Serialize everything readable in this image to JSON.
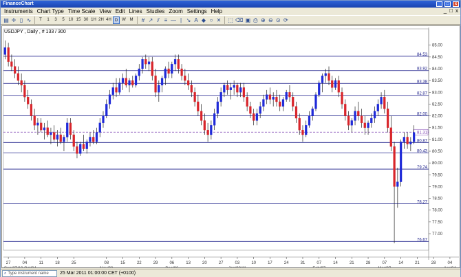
{
  "window": {
    "title": "FinanceChart",
    "controls": [
      "_",
      "□",
      "x"
    ]
  },
  "menu": {
    "items": [
      "Instruments",
      "Chart Type",
      "Time Scale",
      "View",
      "Edit",
      "Lines",
      "Studies",
      "Zoom",
      "Settings",
      "Help"
    ],
    "mdi": [
      "_",
      "□",
      "x"
    ]
  },
  "toolbar": {
    "timeframes": [
      "T",
      "1",
      "3",
      "5",
      "10",
      "15",
      "30",
      "1H",
      "2H",
      "4H",
      "D",
      "W",
      "M"
    ],
    "selected": "D"
  },
  "chart_info": "USDJPY , Daily , # 133 / 300",
  "status": {
    "search_placeholder": "Type instrument name",
    "datetime": "25 Mar 2011 01:00:00 CET (+0100)"
  },
  "colors": {
    "up": "#1f2ad8",
    "down": "#d8252b",
    "level": "#1c1f8a",
    "current": "#7a3fb0"
  },
  "chart_data": {
    "type": "candlestick",
    "title": "",
    "instrument": "USDJPY",
    "timeframe": "Daily",
    "ylim": [
      76.3,
      85.4
    ],
    "y_ticks": [
      "85.00",
      "84.50",
      "84.00",
      "83.50",
      "83.00",
      "82.50",
      "82.00",
      "81.50",
      "81.00",
      "80.50",
      "80.00",
      "79.50",
      "79.00",
      "78.50",
      "78.00",
      "77.50",
      "77.00"
    ],
    "levels": [
      {
        "label": "84.53",
        "value": 84.53
      },
      {
        "label": "83.92",
        "value": 83.92
      },
      {
        "label": "83.38",
        "value": 83.38
      },
      {
        "label": "82.87",
        "value": 82.87
      },
      {
        "label": "82.00",
        "value": 82.0
      },
      {
        "label": "80.87",
        "value": 80.87
      },
      {
        "label": "80.43",
        "value": 80.43
      },
      {
        "label": "79.74",
        "value": 79.74
      },
      {
        "label": "78.27",
        "value": 78.27
      },
      {
        "label": "76.67",
        "value": 76.67
      }
    ],
    "current_price": {
      "label": "81.31",
      "value": 81.31
    },
    "x_labels": [
      {
        "i": 1,
        "label": "27"
      },
      {
        "i": 6,
        "label": "04"
      },
      {
        "i": 11,
        "label": "11"
      },
      {
        "i": 16,
        "label": "18"
      },
      {
        "i": 21,
        "label": "25"
      },
      {
        "i": 31,
        "label": "08"
      },
      {
        "i": 36,
        "label": "15"
      },
      {
        "i": 41,
        "label": "22"
      },
      {
        "i": 46,
        "label": "29"
      },
      {
        "i": 51,
        "label": "06"
      },
      {
        "i": 56,
        "label": "13"
      },
      {
        "i": 61,
        "label": "20"
      },
      {
        "i": 66,
        "label": "27"
      },
      {
        "i": 71,
        "label": "03"
      },
      {
        "i": 76,
        "label": "10"
      },
      {
        "i": 81,
        "label": "17"
      },
      {
        "i": 86,
        "label": "24"
      },
      {
        "i": 91,
        "label": "31"
      },
      {
        "i": 96,
        "label": "07"
      },
      {
        "i": 101,
        "label": "14"
      },
      {
        "i": 106,
        "label": "21"
      },
      {
        "i": 111,
        "label": "28"
      },
      {
        "i": 116,
        "label": "07"
      },
      {
        "i": 121,
        "label": "14"
      },
      {
        "i": 126,
        "label": "21"
      },
      {
        "i": 131,
        "label": "28"
      },
      {
        "i": 136,
        "label": "04"
      }
    ],
    "period_labels": [
      {
        "i": 0,
        "label": "Sep/27/10 Oct/04"
      },
      {
        "i": 31,
        "label": "Nov/08"
      },
      {
        "i": 51,
        "label": "Dec/06"
      },
      {
        "i": 71,
        "label": "Jan/03/11"
      },
      {
        "i": 96,
        "label": "Feb/07"
      },
      {
        "i": 116,
        "label": "Mar/07"
      },
      {
        "i": 136,
        "label": "Apr/04"
      }
    ],
    "candles": [
      [
        84.6,
        85.2,
        84.4,
        84.9
      ],
      [
        84.9,
        85.1,
        84.1,
        84.3
      ],
      [
        84.3,
        84.6,
        83.9,
        84.1
      ],
      [
        84.1,
        84.4,
        83.6,
        83.8
      ],
      [
        83.8,
        84.1,
        83.3,
        83.5
      ],
      [
        83.5,
        83.8,
        83.0,
        83.3
      ],
      [
        83.3,
        83.5,
        82.6,
        82.8
      ],
      [
        82.8,
        83.1,
        82.3,
        82.5
      ],
      [
        82.5,
        82.7,
        81.8,
        82.0
      ],
      [
        82.0,
        82.3,
        81.4,
        81.6
      ],
      [
        81.6,
        81.9,
        81.2,
        81.7
      ],
      [
        81.7,
        81.9,
        81.3,
        81.4
      ],
      [
        81.4,
        81.7,
        81.0,
        81.5
      ],
      [
        81.5,
        81.8,
        81.1,
        81.2
      ],
      [
        81.2,
        81.5,
        80.8,
        81.3
      ],
      [
        81.3,
        81.6,
        80.9,
        81.0
      ],
      [
        81.0,
        81.4,
        80.7,
        81.2
      ],
      [
        81.2,
        81.5,
        80.8,
        80.9
      ],
      [
        80.9,
        81.2,
        80.5,
        81.1
      ],
      [
        81.1,
        81.9,
        80.9,
        81.7
      ],
      [
        81.7,
        81.9,
        81.0,
        81.2
      ],
      [
        81.2,
        81.4,
        80.5,
        80.7
      ],
      [
        80.7,
        80.9,
        80.2,
        80.4
      ],
      [
        80.4,
        80.9,
        80.3,
        80.8
      ],
      [
        80.8,
        81.2,
        80.5,
        80.6
      ],
      [
        80.6,
        81.0,
        80.4,
        80.9
      ],
      [
        80.9,
        81.3,
        80.7,
        81.1
      ],
      [
        81.1,
        81.4,
        80.8,
        80.9
      ],
      [
        80.9,
        81.5,
        80.8,
        81.3
      ],
      [
        81.3,
        81.9,
        81.1,
        81.7
      ],
      [
        81.7,
        82.2,
        81.5,
        82.0
      ],
      [
        82.0,
        82.7,
        81.9,
        82.5
      ],
      [
        82.5,
        83.1,
        82.3,
        82.9
      ],
      [
        82.9,
        83.4,
        82.7,
        83.2
      ],
      [
        83.2,
        83.6,
        82.8,
        83.0
      ],
      [
        83.0,
        83.6,
        82.9,
        83.4
      ],
      [
        83.4,
        83.8,
        83.1,
        83.6
      ],
      [
        83.6,
        84.0,
        83.2,
        83.3
      ],
      [
        83.3,
        83.6,
        83.0,
        83.5
      ],
      [
        83.5,
        83.7,
        83.2,
        83.3
      ],
      [
        83.3,
        83.8,
        83.2,
        83.7
      ],
      [
        83.7,
        84.2,
        83.5,
        84.0
      ],
      [
        84.0,
        84.5,
        83.8,
        84.4
      ],
      [
        84.4,
        84.6,
        84.0,
        84.2
      ],
      [
        84.2,
        84.5,
        83.9,
        84.3
      ],
      [
        84.3,
        84.5,
        83.5,
        83.7
      ],
      [
        83.7,
        84.0,
        82.8,
        83.0
      ],
      [
        83.0,
        83.5,
        82.6,
        83.3
      ],
      [
        83.3,
        83.7,
        83.0,
        83.6
      ],
      [
        83.6,
        84.1,
        83.3,
        84.0
      ],
      [
        84.0,
        84.3,
        83.6,
        83.8
      ],
      [
        83.8,
        84.3,
        83.6,
        84.2
      ],
      [
        84.2,
        84.6,
        83.9,
        84.4
      ],
      [
        84.4,
        84.6,
        83.8,
        84.0
      ],
      [
        84.0,
        84.2,
        83.5,
        83.7
      ],
      [
        83.7,
        84.0,
        83.3,
        83.5
      ],
      [
        83.5,
        83.8,
        83.1,
        83.3
      ],
      [
        83.3,
        83.5,
        82.8,
        83.0
      ],
      [
        83.0,
        83.2,
        82.4,
        82.6
      ],
      [
        82.6,
        82.9,
        82.0,
        82.2
      ],
      [
        82.2,
        82.5,
        81.6,
        81.8
      ],
      [
        81.8,
        82.1,
        81.2,
        81.4
      ],
      [
        81.4,
        81.7,
        80.9,
        81.2
      ],
      [
        81.2,
        81.8,
        81.0,
        81.6
      ],
      [
        81.6,
        82.3,
        81.4,
        82.1
      ],
      [
        82.1,
        82.8,
        81.9,
        82.6
      ],
      [
        82.6,
        83.2,
        82.4,
        83.0
      ],
      [
        83.0,
        83.4,
        82.8,
        83.3
      ],
      [
        83.3,
        83.5,
        82.9,
        83.1
      ],
      [
        83.1,
        83.4,
        82.7,
        83.2
      ],
      [
        83.2,
        83.5,
        82.9,
        83.3
      ],
      [
        83.3,
        83.4,
        82.8,
        83.0
      ],
      [
        83.0,
        83.4,
        82.8,
        83.2
      ],
      [
        83.2,
        83.4,
        82.6,
        82.8
      ],
      [
        82.8,
        83.0,
        82.2,
        82.4
      ],
      [
        82.4,
        82.6,
        81.9,
        82.1
      ],
      [
        82.1,
        82.3,
        81.6,
        81.8
      ],
      [
        81.8,
        82.3,
        81.6,
        82.1
      ],
      [
        82.1,
        82.6,
        81.9,
        82.4
      ],
      [
        82.4,
        82.9,
        82.2,
        82.7
      ],
      [
        82.7,
        83.1,
        82.5,
        82.9
      ],
      [
        82.9,
        83.2,
        82.5,
        82.7
      ],
      [
        82.7,
        83.0,
        82.4,
        82.8
      ],
      [
        82.8,
        83.1,
        82.4,
        82.6
      ],
      [
        82.6,
        82.9,
        82.2,
        82.4
      ],
      [
        82.4,
        82.8,
        82.2,
        82.7
      ],
      [
        82.7,
        83.1,
        82.6,
        83.0
      ],
      [
        83.0,
        83.3,
        82.6,
        82.8
      ],
      [
        82.8,
        83.0,
        82.2,
        82.4
      ],
      [
        82.4,
        82.6,
        81.7,
        81.9
      ],
      [
        81.9,
        82.1,
        81.2,
        81.4
      ],
      [
        81.4,
        81.6,
        80.9,
        81.2
      ],
      [
        81.2,
        81.8,
        81.1,
        81.6
      ],
      [
        81.6,
        82.2,
        81.5,
        82.0
      ],
      [
        82.0,
        82.4,
        81.8,
        82.3
      ],
      [
        82.3,
        83.0,
        82.2,
        82.9
      ],
      [
        82.9,
        83.5,
        82.8,
        83.4
      ],
      [
        83.4,
        83.8,
        83.0,
        83.7
      ],
      [
        83.7,
        84.0,
        83.4,
        83.8
      ],
      [
        83.8,
        84.1,
        83.3,
        83.5
      ],
      [
        83.5,
        83.7,
        83.0,
        83.2
      ],
      [
        83.2,
        83.6,
        83.1,
        83.5
      ],
      [
        83.5,
        83.7,
        82.8,
        83.0
      ],
      [
        83.0,
        83.2,
        82.3,
        82.5
      ],
      [
        82.5,
        82.7,
        81.8,
        82.0
      ],
      [
        82.0,
        82.2,
        81.4,
        81.6
      ],
      [
        81.6,
        81.9,
        81.3,
        81.8
      ],
      [
        81.8,
        82.4,
        81.6,
        82.2
      ],
      [
        82.2,
        82.6,
        81.8,
        82.0
      ],
      [
        82.0,
        82.3,
        81.5,
        81.7
      ],
      [
        81.7,
        82.0,
        81.2,
        81.5
      ],
      [
        81.5,
        81.8,
        81.2,
        81.7
      ],
      [
        81.7,
        82.1,
        81.5,
        81.9
      ],
      [
        81.9,
        82.4,
        81.7,
        82.2
      ],
      [
        82.2,
        82.7,
        82.0,
        82.5
      ],
      [
        82.5,
        83.0,
        82.3,
        82.8
      ],
      [
        82.8,
        83.1,
        82.1,
        82.3
      ],
      [
        82.3,
        82.6,
        81.3,
        81.5
      ],
      [
        81.5,
        82.0,
        80.5,
        80.7
      ],
      [
        80.7,
        80.9,
        76.6,
        79.0
      ],
      [
        79.0,
        79.8,
        78.1,
        79.2
      ],
      [
        79.2,
        81.0,
        79.0,
        80.9
      ],
      [
        80.9,
        81.3,
        80.6,
        81.1
      ],
      [
        81.1,
        81.3,
        80.6,
        80.8
      ],
      [
        80.8,
        81.1,
        80.5,
        80.9
      ],
      [
        80.9,
        81.6,
        80.8,
        81.3
      ]
    ]
  }
}
